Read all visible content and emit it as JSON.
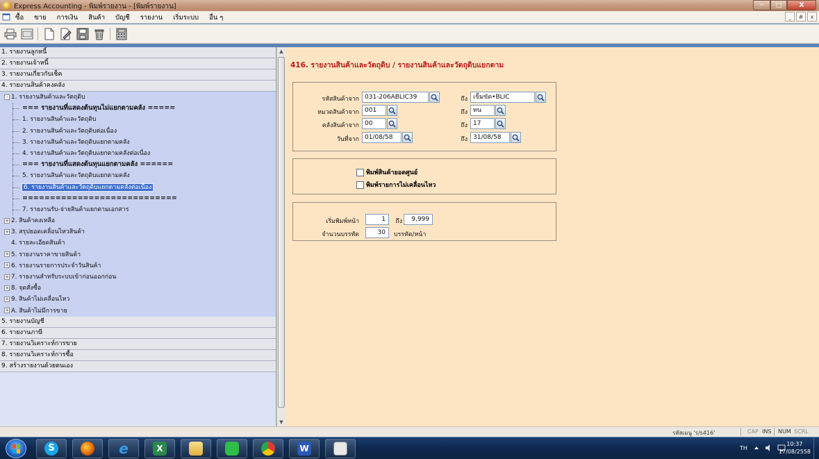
{
  "window": {
    "title": "Express Accounting - พิมพ์รายงาน - [พิมพ์รายงาน]",
    "controls": [
      "─",
      "□",
      "X"
    ]
  },
  "menu": {
    "items": [
      "ซื้อ",
      "ขาย",
      "การเงิน",
      "สินค้า",
      "บัญชี",
      "รายงาน",
      "เริ่มระบบ",
      "อื่น ๆ"
    ],
    "mdi_controls": [
      "_",
      "#",
      "x"
    ]
  },
  "toolbar": {
    "buttons": [
      "print-icon",
      "preview-icon",
      "new-icon",
      "edit-icon",
      "save-icon",
      "delete-icon",
      "calculator-icon"
    ]
  },
  "sidebar": {
    "sections_top": [
      "1. รายงานลูกหนี้",
      "2. รายงานเจ้าหนี้",
      "3. รายงานเกี่ยวกับเช็ค",
      "4. รายงานสินค้าคงคลัง"
    ],
    "tree": [
      {
        "text": "1. รายงานสินค้าและวัตถุดิบ",
        "level": 0,
        "exp": "-"
      },
      {
        "text": "=== รายงานที่แสดงต้นทุนไม่แยกตามคลัง =====",
        "level": 1,
        "bold": true
      },
      {
        "text": "1. รายงานสินค้าและวัตถุดิบ",
        "level": 1
      },
      {
        "text": "2. รายงานสินค้าและวัตถุดิบต่อเนื่อง",
        "level": 1
      },
      {
        "text": "3. รายงานสินค้าและวัตถุดิบแยกตามคลัง",
        "level": 1
      },
      {
        "text": "4. รายงานสินค้าและวัตถุดิบแยกตามคลังต่อเนื่อง",
        "level": 1
      },
      {
        "text": "=== รายงานที่แสดงต้นทุนแยกตามคลัง ======",
        "level": 1,
        "bold": true
      },
      {
        "text": "5. รายงานสินค้าและวัตถุดิบแยกตามคลัง",
        "level": 1
      },
      {
        "text": "6. รายงานสินค้าและวัตถุดิบแยกตามคลังต่อเนื่อง",
        "level": 1,
        "selected": true
      },
      {
        "text": "============================",
        "level": 1,
        "bold": true
      },
      {
        "text": "7. รายงานรับ-จ่ายสินค้าแยกตามเอกสาร",
        "level": 1
      },
      {
        "text": "2. สินค้าคงเหลือ",
        "level": 0,
        "exp": "+"
      },
      {
        "text": "3. สรุปยอดเคลื่อนไหวสินค้า",
        "level": 0,
        "exp": "+"
      },
      {
        "text": "4. รายละเอียดสินค้า",
        "level": 0,
        "exp": ""
      },
      {
        "text": "5. รายงานราคาขายสินค้า",
        "level": 0,
        "exp": "+"
      },
      {
        "text": "6. รายงานรายการประจำวันสินค้า",
        "level": 0,
        "exp": "+"
      },
      {
        "text": "7. รายงานสำหรับระบบเข้าก่อนออกก่อน",
        "level": 0,
        "exp": "+"
      },
      {
        "text": "8. จุดสั่งซื้อ",
        "level": 0,
        "exp": "+"
      },
      {
        "text": "9. สินค้าไม่เคลื่อนไหว",
        "level": 0,
        "exp": "+"
      },
      {
        "text": "A. สินค้าไม่มีการขาย",
        "level": 0,
        "exp": "+"
      }
    ],
    "sections_bottom": [
      "5. รายงานบัญชี",
      "6. รายงานภาษี",
      "7. รายงานวิเคราะห์การขาย",
      "8. รายงานวิเคราะห์การซื้อ",
      "9. สร้างรายงานด้วยตนเอง"
    ]
  },
  "report": {
    "title": "416. รายงานสินค้าและวัตถุดิบ / รายงานสินค้าและวัตถุดิบแยกตาม",
    "filters": [
      {
        "label": "รหัสสินค้าจาก",
        "from": "031-206ABLIC39",
        "to_label": "ถึง",
        "to": "เข็มขัด•BLIC"
      },
      {
        "label": "หมวดสินค้าจาก",
        "from": "001",
        "to_label": "ถึง",
        "to": "ทน"
      },
      {
        "label": "คลังสินค้าจาก",
        "from": "00",
        "to_label": "ถึง",
        "to": "17"
      },
      {
        "label": "วันที่จาก",
        "from": "01/08/58",
        "to_label": "ถึง",
        "to": "31/08/58"
      }
    ],
    "options": [
      {
        "label": "พิมพ์สินค้ายอดศูนย์",
        "checked": false
      },
      {
        "label": "พิมพ์รายการไม่เคลื่อนไหว",
        "checked": false
      }
    ],
    "page_label": "เริ่มพิมพ์หน้า",
    "page_from": "1",
    "page_to_label": "ถึง",
    "page_to": "9,999",
    "lines_label": "จำนวนบรรทัด",
    "lines_value": "30",
    "lines_unit": "บรรทัด/หน้า"
  },
  "statusbar": {
    "report_code": "รหัสเมนู 'ร/s416'",
    "cap": "CAP",
    "ins": "INS",
    "num": "NUM",
    "scrl": "SCRL"
  },
  "taskbar": {
    "apps": [
      "start-icon",
      "skype-icon",
      "firefox-icon",
      "ie-icon",
      "excel-icon",
      "explorer-icon",
      "line-icon",
      "chrome-icon",
      "word-icon",
      "express-icon"
    ],
    "lang": "TH",
    "time": "10:37",
    "date": "17/08/2558"
  }
}
